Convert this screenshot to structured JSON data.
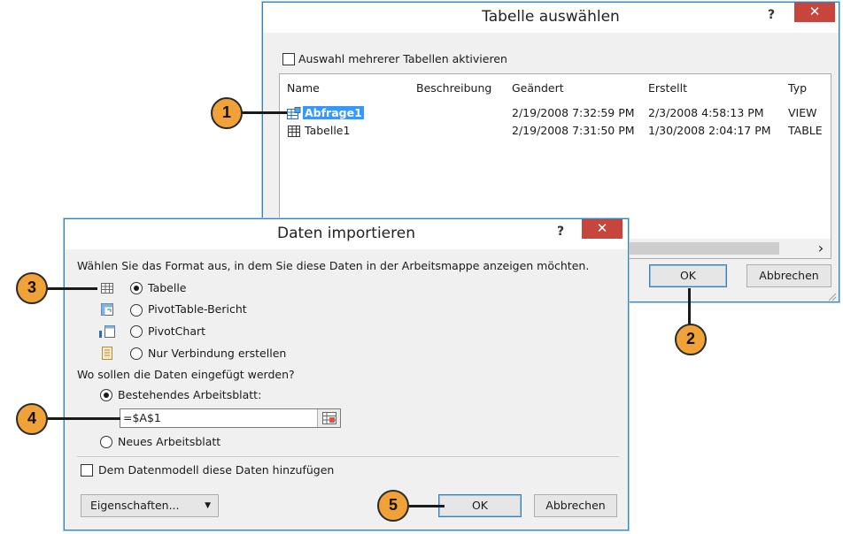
{
  "table_dialog": {
    "title": "Tabelle auswählen",
    "help": "?",
    "close": "✕",
    "multi_select_label": "Auswahl mehrerer Tabellen aktivieren",
    "columns": [
      "Name",
      "Beschreibung",
      "Geändert",
      "Erstellt",
      "Typ"
    ],
    "rows": [
      {
        "name": "Abfrage1",
        "description": "",
        "modified": "2/19/2008 7:32:59 PM",
        "created": "2/3/2008 4:58:13 PM",
        "type": "VIEW",
        "selected": true
      },
      {
        "name": "Tabelle1",
        "description": "",
        "modified": "2/19/2008 7:31:50 PM",
        "created": "1/30/2008 2:04:17 PM",
        "type": "TABLE",
        "selected": false
      }
    ],
    "scroll_right": "›",
    "ok": "OK",
    "cancel": "Abbrechen"
  },
  "import_dialog": {
    "title": "Daten importieren",
    "help": "?",
    "close": "✕",
    "format_prompt": "Wählen Sie das Format aus, in dem Sie diese Daten in der Arbeitsmappe anzeigen möchten.",
    "format_options": [
      "Tabelle",
      "PivotTable-Bericht",
      "PivotChart",
      "Nur Verbindung erstellen"
    ],
    "selected_format": "Tabelle",
    "location_prompt": "Wo sollen die Daten eingefügt werden?",
    "existing_sheet_label": "Bestehendes Arbeitsblatt:",
    "existing_sheet_selected": true,
    "range_value": "=$A$1",
    "new_sheet_label": "Neues Arbeitsblatt",
    "data_model_label": "Dem Datenmodell diese Daten hinzufügen",
    "properties": "Eigenschaften...",
    "ok": "OK",
    "cancel": "Abbrechen"
  },
  "callouts": [
    "1",
    "2",
    "3",
    "4",
    "5"
  ],
  "colors": {
    "accent": "#2d84c8",
    "close": "#c7463c",
    "callout": "#f0a239",
    "selection": "#3399ff"
  }
}
